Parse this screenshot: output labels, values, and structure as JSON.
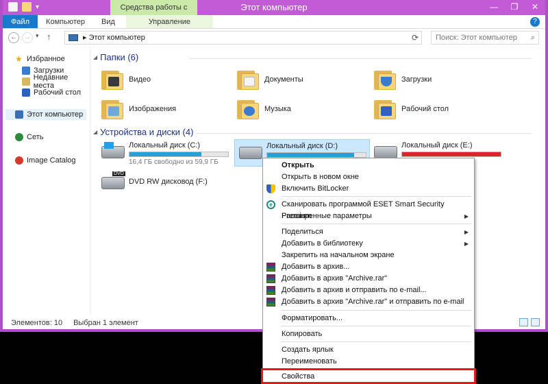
{
  "window": {
    "title": "Этот компьютер",
    "contextual_tab_header": "Средства работы с дисками",
    "controls": [
      "—",
      "❐",
      "✕"
    ]
  },
  "ribbon": {
    "tabs": [
      "Файл",
      "Компьютер",
      "Вид",
      "Управление"
    ]
  },
  "address": {
    "path_root": "▸",
    "path": "Этот компьютер",
    "search_placeholder": "Поиск: Этот компьютер"
  },
  "nav": {
    "favorites": "Избранное",
    "downloads": "Загрузки",
    "recent": "Недавние места",
    "desktop": "Рабочий стол",
    "this_pc": "Этот компьютер",
    "network": "Сеть",
    "image_catalog": "Image Catalog"
  },
  "folders": {
    "header": "Папки (6)",
    "items": [
      "Видео",
      "Документы",
      "Загрузки",
      "Изображения",
      "Музыка",
      "Рабочий стол"
    ]
  },
  "drives": {
    "header": "Устройства и диски (4)",
    "c": {
      "name": "Локальный диск (C:)",
      "free": "16,4 ГБ свободно из 59,9 ГБ",
      "used_fraction": 0.73
    },
    "d": {
      "name": "Локальный диск (D:)",
      "used_fraction": 0.88
    },
    "e": {
      "name": "Локальный диск (E:)",
      "used_fraction": 1.0
    },
    "f": {
      "name": "DVD RW дисковод (F:)",
      "badge": "DVD"
    }
  },
  "status": {
    "count": "Элементов: 10",
    "selected": "Выбран 1 элемент"
  },
  "context_menu": {
    "open": "Открыть",
    "open_new_window": "Открыть в новом окне",
    "bitlocker": "Включить BitLocker",
    "eset_scan": "Сканировать программой ESET Smart Security Premium",
    "advanced": "Расширенные параметры",
    "share": "Поделиться",
    "add_library": "Добавить в библиотеку",
    "pin_start": "Закрепить на начальном экране",
    "add_archive": "Добавить в архив...",
    "add_archive_rar": "Добавить в архив \"Archive.rar\"",
    "add_archive_email": "Добавить в архив и отправить по e-mail...",
    "add_archive_rar_email": "Добавить в архив \"Archive.rar\" и отправить по e-mail",
    "format": "Форматировать...",
    "copy": "Копировать",
    "create_shortcut": "Создать ярлык",
    "rename": "Переименовать",
    "properties": "Свойства"
  },
  "colors": {
    "titlebar": "#c25ad6",
    "file_tab": "#1979ca",
    "contextual_tab": "#c9e9a8",
    "drive_bar": "#26a0da",
    "drive_bar_full": "#da2626",
    "highlight": "#e8171f"
  }
}
